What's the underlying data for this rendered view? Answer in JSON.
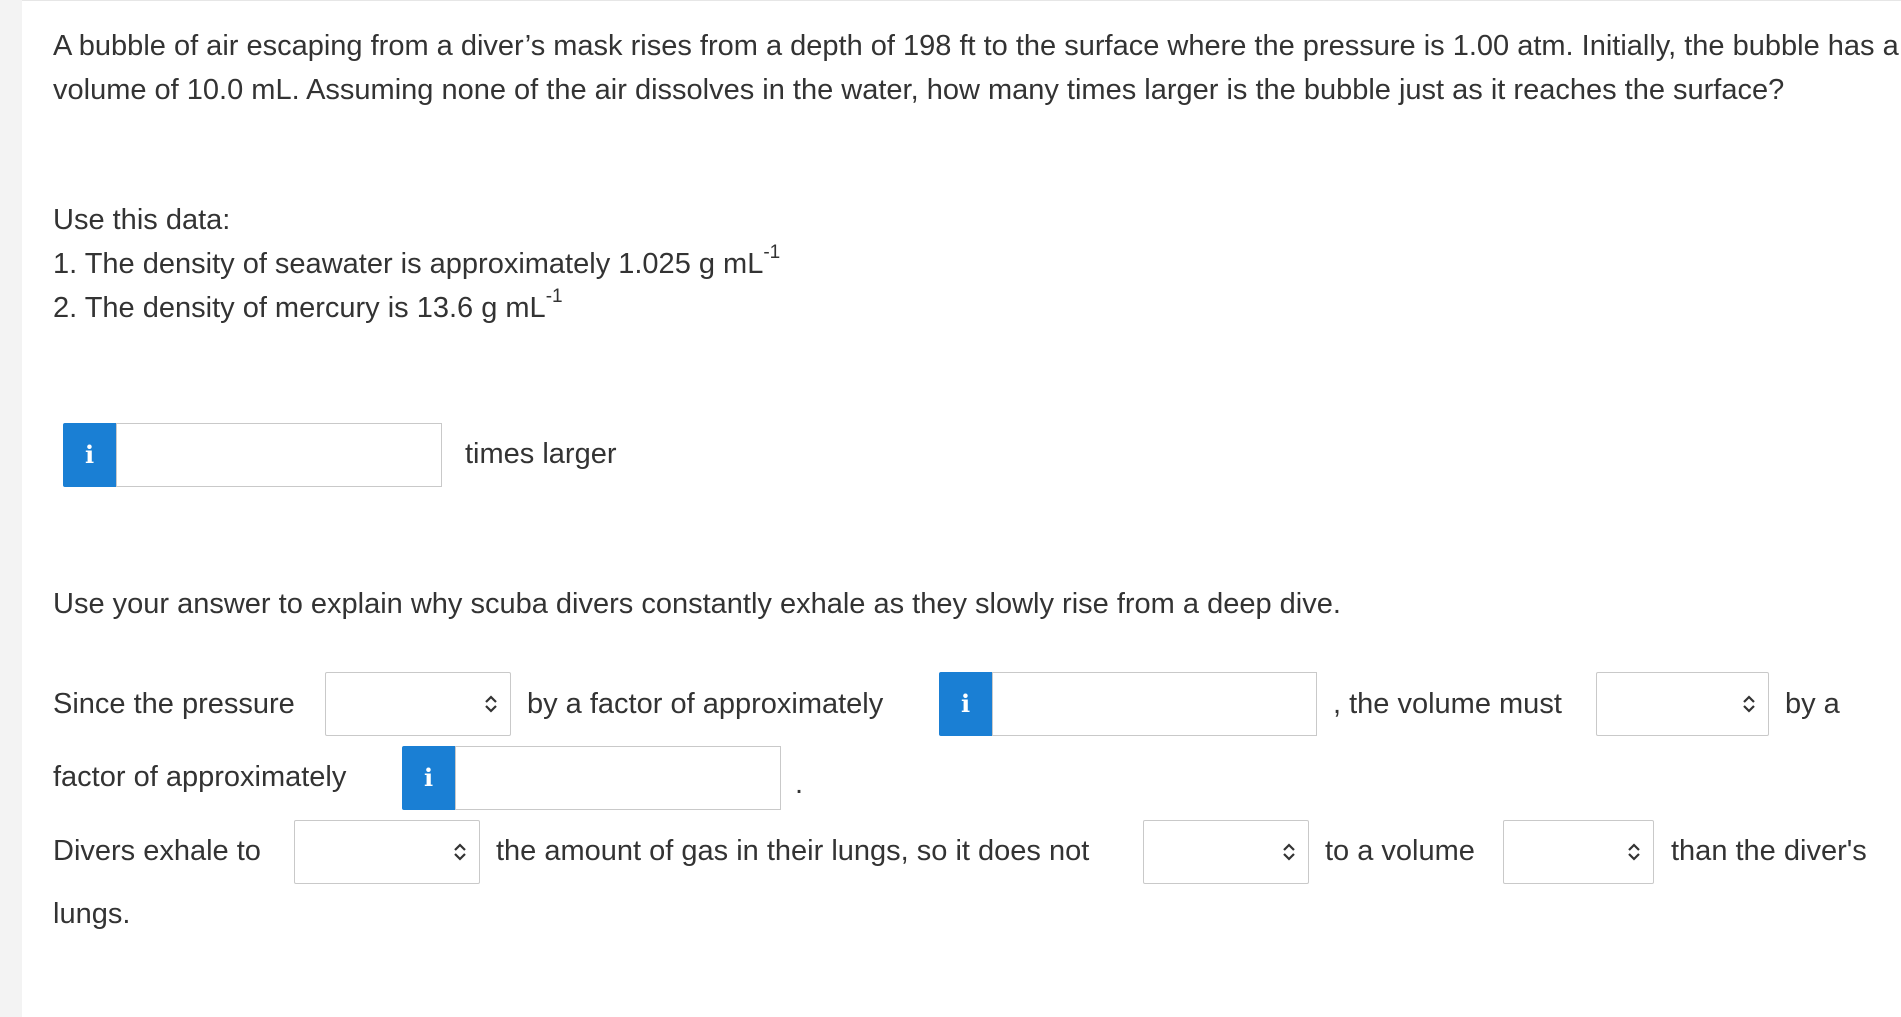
{
  "question": {
    "prompt": "A bubble of air escaping from a diver’s mask rises from a depth of 198 ft to the surface where the pressure is 1.00 atm. Initially, the bubble has a volume of 10.0 mL. Assuming none of the air dissolves in the water, how many times larger is the bubble just as it reaches the surface?",
    "data_heading": "Use this data:",
    "data_items": [
      {
        "text": "1. The density of seawater is approximately 1.025 g mL",
        "sup": "-1"
      },
      {
        "text": "2. The density of mercury is 13.6 g mL",
        "sup": "-1"
      }
    ]
  },
  "answer1": {
    "info_icon": "i",
    "value": "",
    "unit_label": "times larger"
  },
  "explain_prompt": "Use your answer to explain why scuba divers constantly exhale as they slowly rise from a deep dive.",
  "sentence1": {
    "part1": "Since the pressure",
    "select1_value": "",
    "part2": "by a factor of approximately",
    "info_icon": "i",
    "input1_value": "",
    "part3": ", the volume must",
    "select2_value": "",
    "part4": "by a",
    "part5": "factor of approximately",
    "input2_value": "",
    "part6": "."
  },
  "sentence2": {
    "part1": "Divers exhale to",
    "select1_value": "",
    "part2": "the amount of gas in their lungs, so it does not",
    "select2_value": "",
    "part3": "to a volume",
    "select3_value": "",
    "part4": "than the diver's",
    "part5": "lungs."
  },
  "colors": {
    "accent": "#1a7fd4",
    "text": "#333333",
    "border": "#c9c9c9"
  },
  "icons": {
    "info": "info-icon",
    "select": "updown-chevron-icon"
  }
}
